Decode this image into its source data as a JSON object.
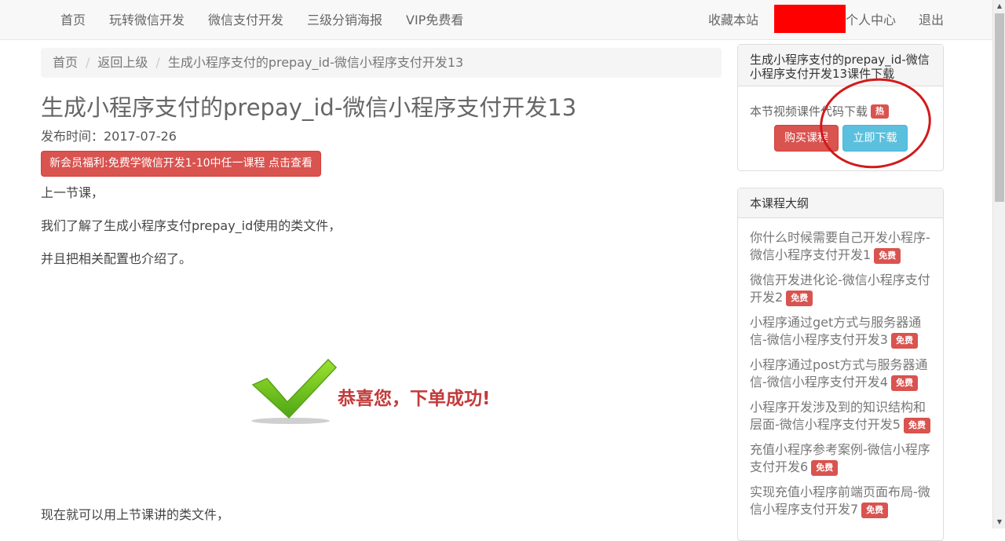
{
  "nav": {
    "left": [
      "首页",
      "玩转微信开发",
      "微信支付开发",
      "三级分销海报",
      "VIP免费看"
    ],
    "right": [
      "收藏本站",
      "个人中心",
      "退出"
    ]
  },
  "breadcrumb": [
    "首页",
    "返回上级",
    "生成小程序支付的prepay_id-微信小程序支付开发13"
  ],
  "article": {
    "title": "生成小程序支付的prepay_id-微信小程序支付开发13",
    "publish_time": "发布时间：2017-07-26",
    "promo_button": "新会员福利:免费学微信开发1-10中任一课程 点击查看",
    "paragraphs": [
      "上一节课，",
      "我们了解了生成小程序支付prepay_id使用的类文件，",
      "并且把相关配置也介绍了。",
      "现在就可以用上节课讲的类文件，"
    ],
    "success_text": "恭喜您，下单成功!"
  },
  "download_panel": {
    "title": "生成小程序支付的prepay_id-微信小程序支付开发13课件下载",
    "text": "本节视频课件代码下载",
    "hot_badge": "热",
    "buy_button": "购买课程",
    "download_button": "立即下载"
  },
  "outline_panel": {
    "title": "本课程大纲",
    "badge": "免费",
    "items": [
      "你什么时候需要自己开发小程序-微信小程序支付开发1",
      "微信开发进化论-微信小程序支付开发2",
      "小程序通过get方式与服务器通信-微信小程序支付开发3",
      "小程序通过post方式与服务器通信-微信小程序支付开发4",
      "小程序开发涉及到的知识结构和层面-微信小程序支付开发5",
      "充值小程序参考案例-微信小程序支付开发6",
      "实现充值小程序前端页面布局-微信小程序支付开发7"
    ]
  },
  "colors": {
    "danger": "#d9534f",
    "info": "#5bc0de",
    "annotation_circle": "#d21a1a",
    "redaction": "#ff0000",
    "check_green": "#6cc11e"
  }
}
